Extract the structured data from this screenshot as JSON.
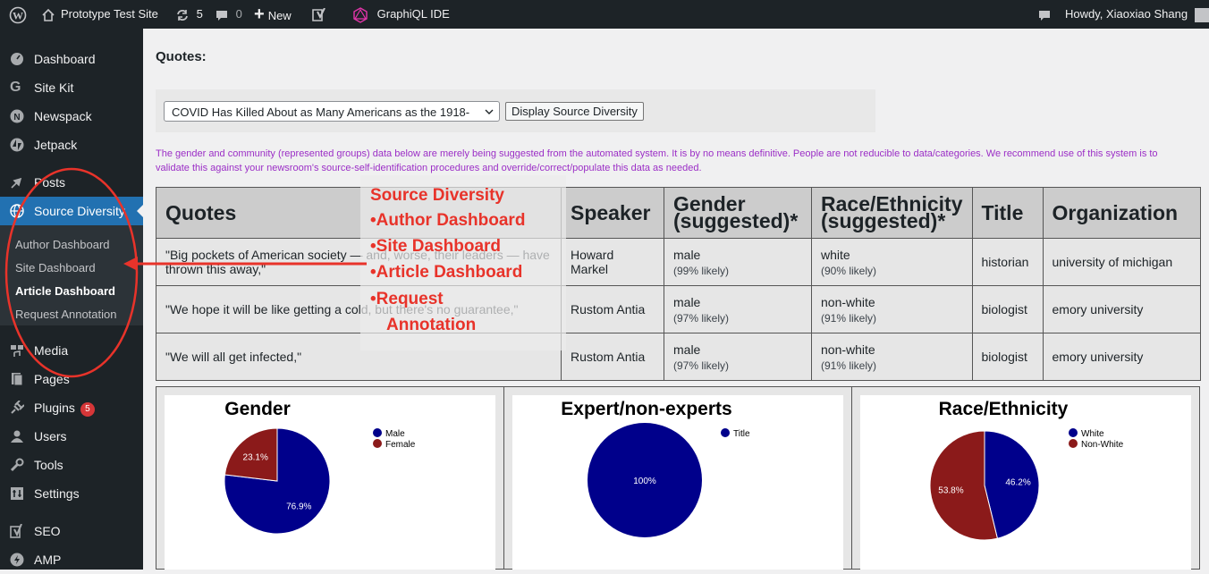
{
  "adminbar": {
    "site_name": "Prototype Test Site",
    "updates_count": "5",
    "comments_count": "0",
    "new_label": "New",
    "graphiql_label": "GraphiQL IDE",
    "howdy": "Howdy, Xiaoxiao Shang"
  },
  "sidebar": {
    "dashboard": "Dashboard",
    "site_kit": "Site Kit",
    "newspack": "Newspack",
    "jetpack": "Jetpack",
    "posts": "Posts",
    "source_diversity": "Source Diversity",
    "submenu": [
      "Author Dashboard",
      "Site Dashboard",
      "Article Dashboard",
      "Request Annotation"
    ],
    "media": "Media",
    "pages": "Pages",
    "plugins": "Plugins",
    "plugins_badge": "5",
    "users": "Users",
    "tools": "Tools",
    "settings": "Settings",
    "seo": "SEO",
    "amp": "AMP"
  },
  "main": {
    "title": "Quotes:",
    "select_value": "COVID Has Killed About as Many Americans as the 1918-",
    "display_button": "Display Source Diversity",
    "notice": "The gender and community (represented groups) data below are merely being suggested from the automated system. It is by no means definitive. People are not reducible to data/categories. We recommend use of this system is to validate this against your newsroom's source-self-identification procedures and override/correct/populate this data as needed."
  },
  "table": {
    "headers": [
      "Quotes",
      "Speaker",
      "Gender (suggested)*",
      "Race/Ethnicity (suggested)*",
      "Title",
      "Organization"
    ],
    "rows": [
      {
        "quote": "\"Big pockets of American society — and, worse, their leaders — have thrown this away,\"",
        "speaker": "Howard Markel",
        "gender": "male",
        "gender_conf": "(99% likely)",
        "race": "white",
        "race_conf": "(90% likely)",
        "title": "historian",
        "org": "university of michigan"
      },
      {
        "quote": "\"We hope it will be like getting a cold, but there's no guarantee,\"",
        "speaker": "Rustom Antia",
        "gender": "male",
        "gender_conf": "(97% likely)",
        "race": "non-white",
        "race_conf": "(91% likely)",
        "title": "biologist",
        "org": "emory university"
      },
      {
        "quote": "\"We will all get infected,\"",
        "speaker": "Rustom Antia",
        "gender": "male",
        "gender_conf": "(97% likely)",
        "race": "non-white",
        "race_conf": "(91% likely)",
        "title": "biologist",
        "org": "emory university"
      }
    ]
  },
  "annotation": {
    "lines": [
      "Source Diversity",
      "•Author Dashboard",
      "•Site Dashboard",
      "•Article Dashboard",
      "•Request",
      "Annotation"
    ],
    "color": "#e8332a"
  },
  "chart_data": [
    {
      "type": "pie",
      "title": "Gender",
      "labels": [
        "Male",
        "Female"
      ],
      "values": [
        76.9,
        23.1
      ],
      "colors": [
        "#00008b",
        "#8b1a1a"
      ],
      "legend": "top-right"
    },
    {
      "type": "pie",
      "title": "Expert/non-experts",
      "labels": [
        "Title"
      ],
      "values": [
        100
      ],
      "colors": [
        "#00008b"
      ],
      "legend": "top-right"
    },
    {
      "type": "pie",
      "title": "Race/Ethnicity",
      "labels": [
        "White",
        "Non-White"
      ],
      "values": [
        46.2,
        53.8
      ],
      "colors": [
        "#00008b",
        "#8b1a1a"
      ],
      "legend": "top-right"
    }
  ],
  "colors": {
    "admin_bg": "#1d2327",
    "accent": "#2271b1",
    "notice": "#9b2ec6"
  }
}
